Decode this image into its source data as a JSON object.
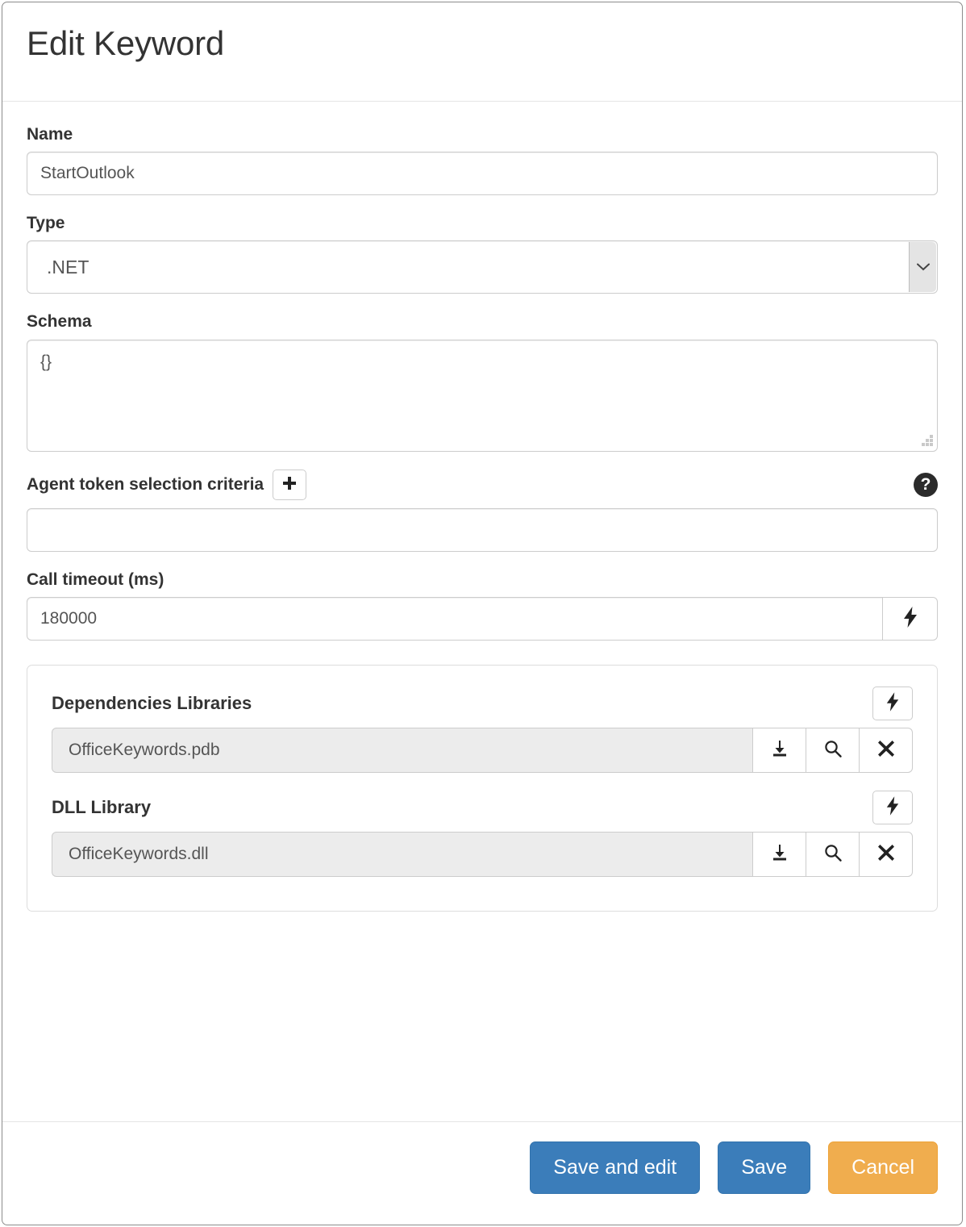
{
  "dialog": {
    "title": "Edit Keyword"
  },
  "form": {
    "name": {
      "label": "Name",
      "value": "StartOutlook",
      "placeholder": ""
    },
    "type": {
      "label": "Type",
      "value": ".NET",
      "options": [
        ".NET"
      ]
    },
    "schema": {
      "label": "Schema",
      "value": "{}",
      "placeholder": ""
    },
    "agent_token": {
      "label": "Agent token selection criteria",
      "add_icon": "plus-icon",
      "help_icon": "question-mark-icon",
      "help_glyph": "?",
      "value": "",
      "placeholder": ""
    },
    "call_timeout": {
      "label": "Call timeout (ms)",
      "value": "180000",
      "placeholder": "",
      "dynamic_icon": "lightning-bolt-icon"
    }
  },
  "libraries": {
    "dependencies": {
      "label": "Dependencies Libraries",
      "dynamic_icon": "lightning-bolt-icon",
      "file": "OfficeKeywords.pdb",
      "actions": [
        {
          "name": "download-icon"
        },
        {
          "name": "search-icon"
        },
        {
          "name": "remove-icon"
        }
      ]
    },
    "dll": {
      "label": "DLL Library",
      "dynamic_icon": "lightning-bolt-icon",
      "file": "OfficeKeywords.dll",
      "actions": [
        {
          "name": "download-icon"
        },
        {
          "name": "search-icon"
        },
        {
          "name": "remove-icon"
        }
      ]
    }
  },
  "footer": {
    "save_and_edit_label": "Save and edit",
    "save_label": "Save",
    "cancel_label": "Cancel"
  },
  "colors": {
    "primary": "#3b7dba",
    "warning": "#f0ad4e",
    "border": "#cccccc",
    "file_input_bg": "#ececec"
  }
}
